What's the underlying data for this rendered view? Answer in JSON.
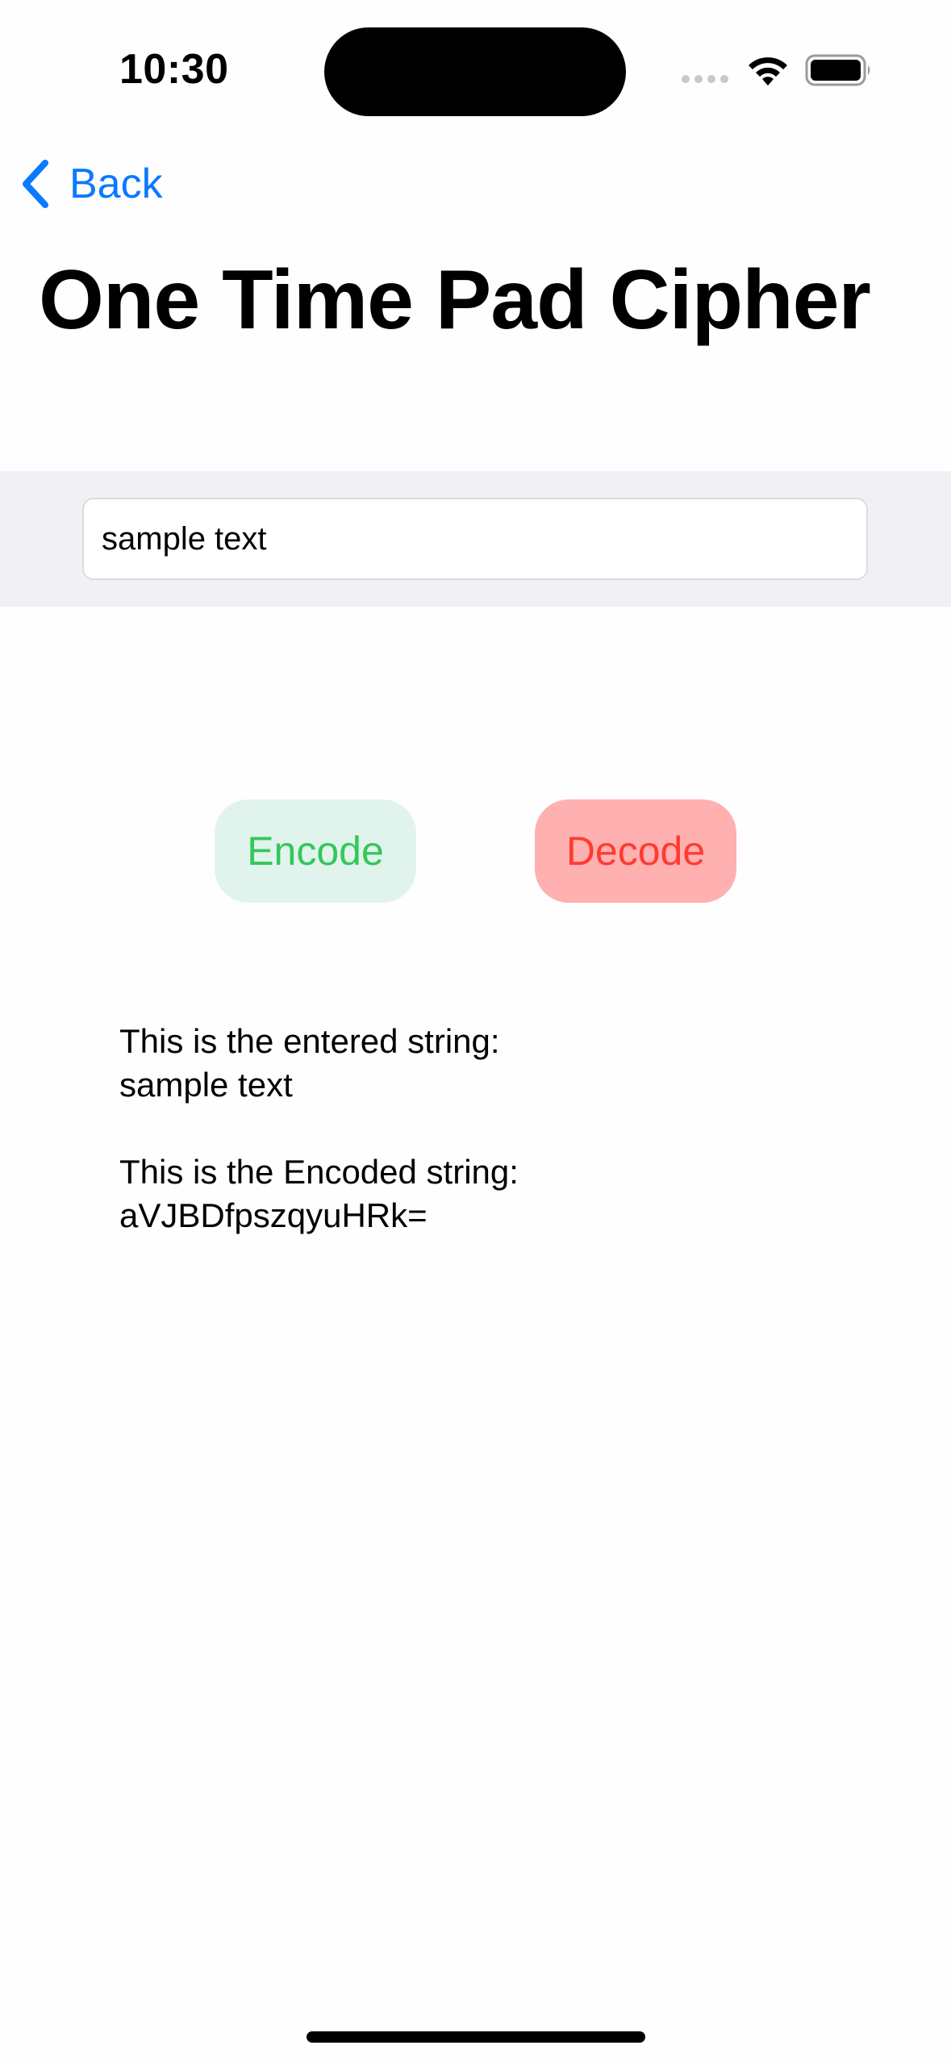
{
  "status_bar": {
    "time": "10:30",
    "icons": [
      "cellular-signal-icon",
      "wifi-icon",
      "battery-icon"
    ]
  },
  "nav": {
    "back_label": "Back",
    "back_icon": "chevron-left-icon"
  },
  "title": "One Time Pad Cipher",
  "input": {
    "value": "sample text",
    "placeholder": ""
  },
  "buttons": {
    "encode_label": "Encode",
    "decode_label": "Decode"
  },
  "output": {
    "entered_label": "This is the entered string:",
    "entered_value": "sample text",
    "encoded_label": "This is the Encoded string:",
    "encoded_value": "aVJBDfpszqyuHRk="
  },
  "colors": {
    "accent_blue": "#0a7aff",
    "encode_text": "#34c759",
    "encode_bg": "#e1f3ed",
    "decode_text": "#ff3b30",
    "decode_bg": "#ffb0b0",
    "input_band_bg": "#f1f1f5"
  }
}
